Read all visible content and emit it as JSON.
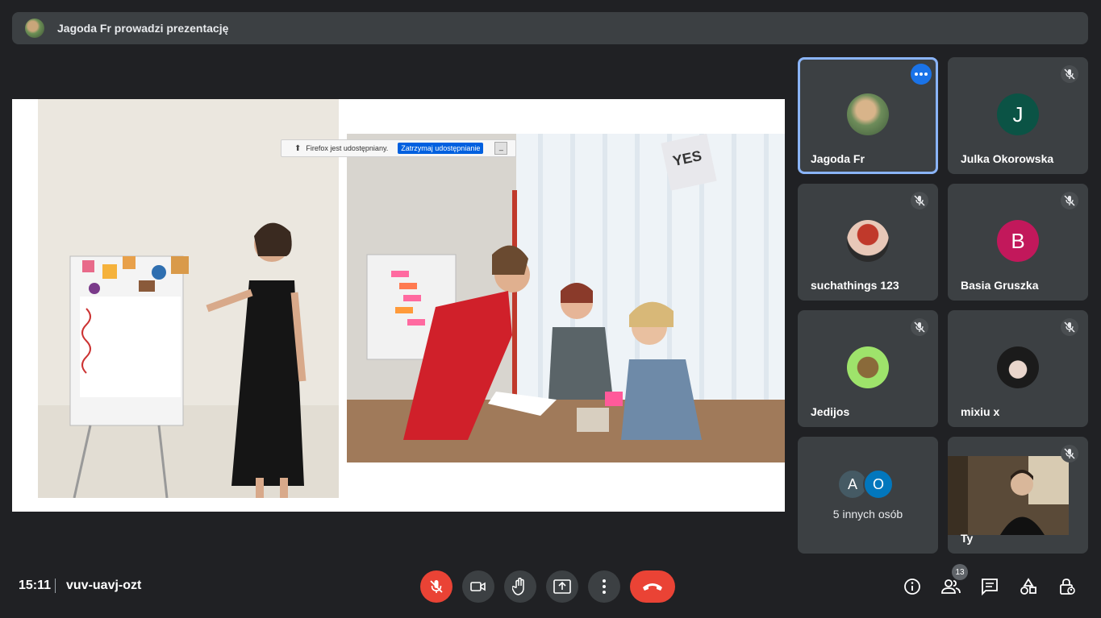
{
  "header": {
    "title": "Jagoda Fr prowadzi prezentację"
  },
  "share_bar": {
    "message": "Firefox jest udostępniany.",
    "stop_label": "Zatrzymaj udostępnianie",
    "minimize_label": "_"
  },
  "sign_text": "YES",
  "participants": [
    {
      "name": "Jagoda Fr",
      "initial": "",
      "color": "#7a8f6a",
      "muted": false,
      "active": true
    },
    {
      "name": "Julka Okorowska",
      "initial": "J",
      "color": "#0b5345",
      "muted": true
    },
    {
      "name": "suchathings 123",
      "initial": "",
      "color": "#a03030",
      "muted": true
    },
    {
      "name": "Basia Gruszka",
      "initial": "B",
      "color": "#c2185b",
      "muted": true
    },
    {
      "name": "Jedijos",
      "initial": "",
      "color": "#9ee36b",
      "muted": true
    },
    {
      "name": "mixiu x",
      "initial": "",
      "color": "#1b1b1b",
      "muted": true
    }
  ],
  "others": {
    "label": "5 innych osób",
    "avatars": [
      {
        "initial": "A",
        "color": "#455a64"
      },
      {
        "initial": "O",
        "color": "#0277bd"
      }
    ]
  },
  "self": {
    "name": "Ty",
    "muted": true
  },
  "bottom": {
    "time": "15:11",
    "meeting_code": "vuv-uavj-ozt",
    "people_count": "13"
  },
  "colors": {
    "accent": "#8ab4f8",
    "end_call": "#ea4335",
    "more_button": "#1a73e8"
  }
}
